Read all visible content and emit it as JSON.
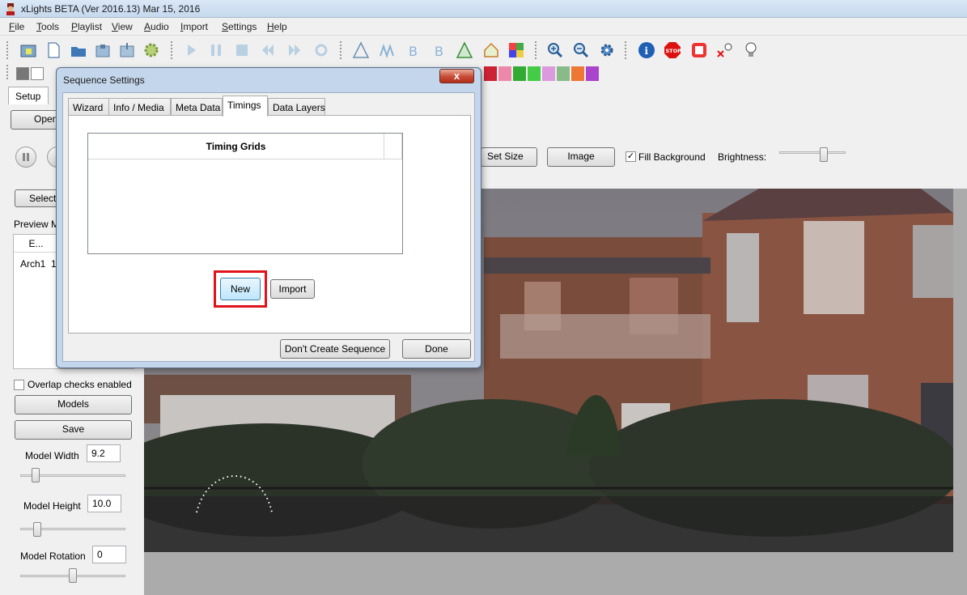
{
  "window": {
    "title": "xLights BETA (Ver 2016.13) Mar 15, 2016"
  },
  "menu": [
    "File",
    "Tools",
    "Playlist",
    "View",
    "Audio",
    "Import",
    "Settings",
    "Help"
  ],
  "toolbar_icons": [
    "open-folder-icon",
    "new-file-icon",
    "open-icon",
    "save-icon",
    "save-as-icon",
    "render-gear-icon",
    "play-icon",
    "pause-icon",
    "stop-icon",
    "first-frame-icon",
    "last-frame-icon",
    "repeat-icon",
    "tool-a-icon",
    "tool-b-icon",
    "tool-c-icon",
    "tool-d-icon",
    "tool-e-icon",
    "house-icon",
    "colorful-icon",
    "zoom-in-icon",
    "zoom-out-icon",
    "settings-gear-icon",
    "info-icon",
    "stop-sign-icon",
    "stop-render-icon",
    "bulb-off-icon",
    "bulb-icon"
  ],
  "left": {
    "setup_tab": "Setup",
    "open_button": "Open",
    "select_button": "Select",
    "preview_models_label": "Preview M",
    "list_header": "E...",
    "list_row_name": "Arch1",
    "list_row_value": "1",
    "overlap_label": "Overlap checks enabled",
    "models_button": "Models",
    "save_button": "Save",
    "model_width_label": "Model Width",
    "model_width_value": "9.2",
    "model_height_label": "Model Height",
    "model_height_value": "10.0",
    "model_rotation_label": "Model Rotation",
    "model_rotation_value": "0"
  },
  "preview_controls": {
    "set_size_button": "Set Size",
    "image_button": "Image",
    "fill_background_label": "Fill Background",
    "fill_background_checked": true,
    "brightness_label": "Brightness:"
  },
  "dialog": {
    "title": "Sequence Settings",
    "close_label": "x",
    "tabs": [
      "Wizard",
      "Info / Media",
      "Meta Data",
      "Timings",
      "Data Layers"
    ],
    "active_tab": "Timings",
    "grid_header": "Timing Grids",
    "new_button": "New",
    "import_button": "Import",
    "dont_create_button": "Don't Create Sequence",
    "done_button": "Done"
  },
  "colors": {
    "highlight": "#e0131a",
    "dialog_frame": "#c4d6eb"
  }
}
